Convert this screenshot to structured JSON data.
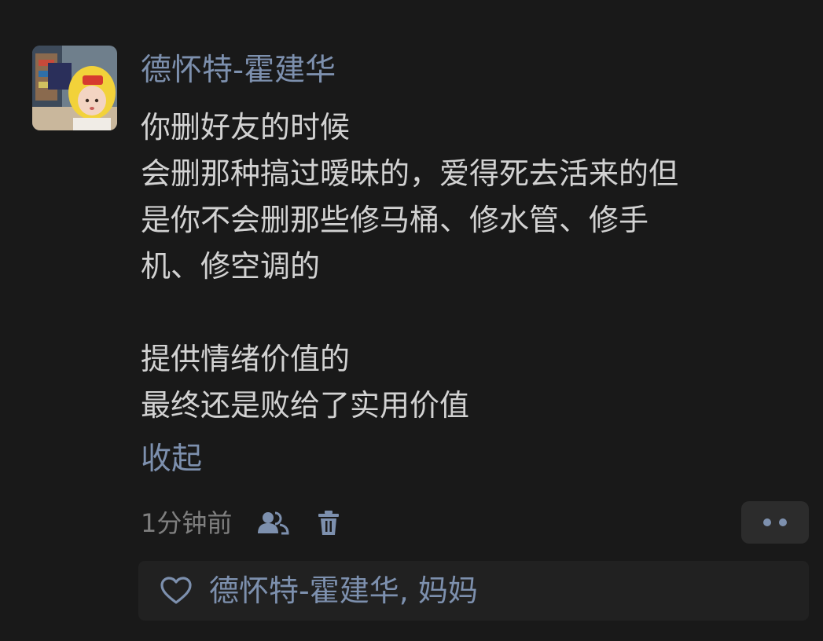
{
  "post": {
    "author": "德怀特-霍建华",
    "lines": [
      "你删好友的时候",
      "会删那种搞过暧昧的，爱得死去活来的但",
      "是你不会删那些修马桶、修水管、修手",
      "机、修空调的",
      "",
      "提供情绪价值的",
      "最终还是败给了实用价值"
    ],
    "collapse_label": "收起",
    "timestamp": "1分钟前",
    "icons": {
      "avatar": "avatar-photo",
      "visibility": "friends-visibility-icon",
      "delete": "trash-icon",
      "more": "more-dots-icon",
      "like": "heart-outline-icon"
    }
  },
  "likes": {
    "names": [
      "德怀特-霍建华",
      "妈妈"
    ],
    "separator": ", "
  },
  "colors": {
    "background": "#191919",
    "link": "#7d90ae",
    "text": "#d2d2d2",
    "muted": "#7f7f7f",
    "panel": "#212121"
  }
}
